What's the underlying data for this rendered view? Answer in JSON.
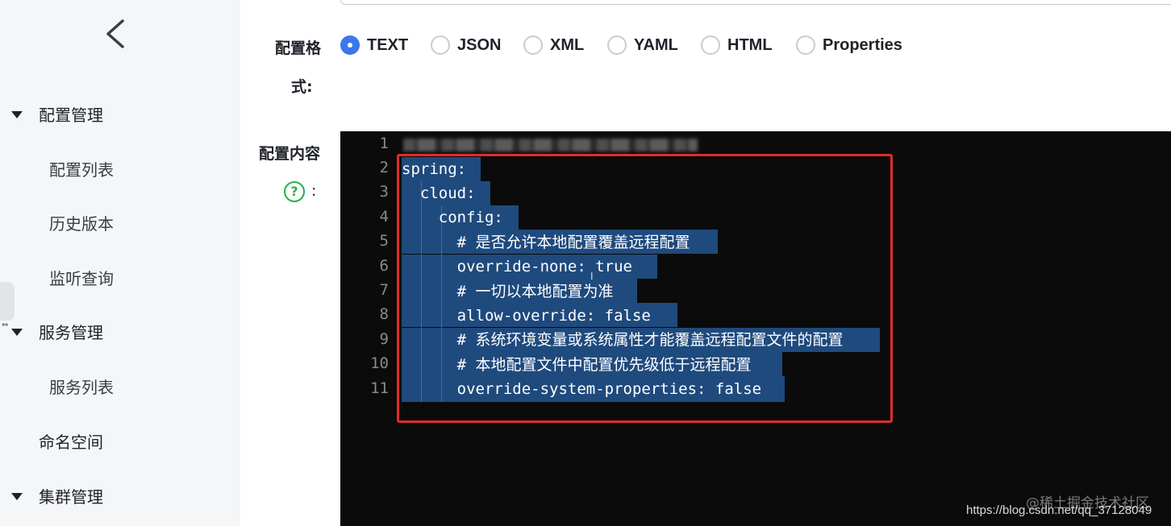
{
  "sidebar": {
    "back_icon": "chevron-left-icon",
    "groups": [
      {
        "label": "配置管理",
        "items": [
          "配置列表",
          "历史版本",
          "监听查询"
        ]
      },
      {
        "label": "服务管理",
        "items": [
          "服务列表"
        ]
      },
      {
        "label": "命名空间"
      },
      {
        "label": "集群管理"
      }
    ]
  },
  "form": {
    "format_label_line1": "配置格",
    "format_label_line2": "式:",
    "formats": [
      "TEXT",
      "JSON",
      "XML",
      "YAML",
      "HTML",
      "Properties"
    ],
    "selected_format": "TEXT",
    "content_label": "配置内容",
    "help_icon": "question-circle-icon",
    "help_glyph": "?",
    "help_colon": ":"
  },
  "editor": {
    "line_numbers": [
      "1",
      "2",
      "3",
      "4",
      "5",
      "6",
      "7",
      "8",
      "9",
      "10",
      "11"
    ],
    "lines": [
      "",
      "spring:",
      "  cloud:",
      "    config:",
      "      # 是否允许本地配置覆盖远程配置",
      "      override-none: true",
      "      # 一切以本地配置为准",
      "      allow-override: false",
      "      # 系统环境变量或系统属性才能覆盖远程配置文件的配置",
      "      # 本地配置文件中配置优先级低于远程配置",
      "      override-system-properties: false"
    ]
  },
  "watermark": {
    "site": "@稀土掘金技术社区",
    "url": "https://blog.csdn.net/qq_37128049"
  },
  "colors": {
    "accent": "#3a78ea",
    "selection": "#1f4a7d",
    "highlight_border": "#e12b2b",
    "help_green": "#27b148"
  }
}
